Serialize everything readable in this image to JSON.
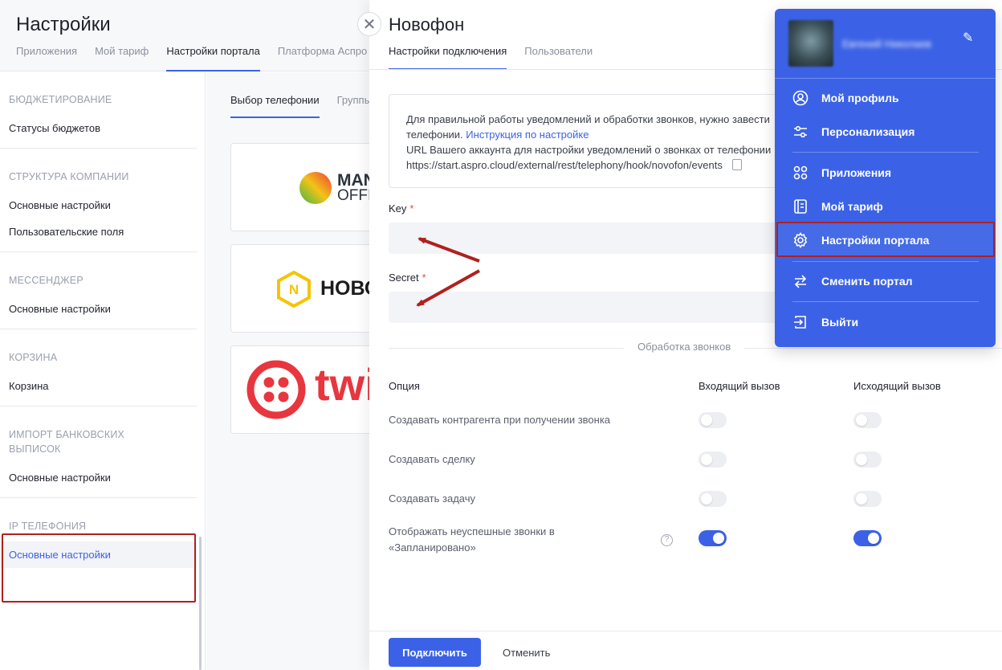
{
  "settings": {
    "title": "Настройки",
    "tabs": [
      "Приложения",
      "Мой тариф",
      "Настройки портала",
      "Платформа Аспро"
    ],
    "active_tab": "Настройки портала"
  },
  "sidebar": {
    "sections": [
      {
        "heading": "БЮДЖЕТИРОВАНИЕ",
        "items": [
          "Статусы бюджетов"
        ]
      },
      {
        "heading": "СТРУКТУРА КОМПАНИИ",
        "items": [
          "Основные настройки",
          "Пользовательские поля"
        ]
      },
      {
        "heading": "МЕССЕНДЖЕР",
        "items": [
          "Основные настройки"
        ]
      },
      {
        "heading": "КОРЗИНА",
        "items": [
          "Корзина"
        ]
      },
      {
        "heading": "ИМПОРТ БАНКОВСКИХ ВЫПИСОК",
        "items": [
          "Основные настройки"
        ]
      },
      {
        "heading": "IP ТЕЛЕФОНИЯ",
        "items": [
          "Основные настройки"
        ]
      }
    ],
    "active_item": "Основные настройки"
  },
  "telephony": {
    "tabs": [
      "Выбор телефонии",
      "Группы"
    ],
    "providers": [
      {
        "name": "MANGO OFFICE",
        "line1": "MANGO",
        "line2": "OFFICE"
      },
      {
        "name": "НОВОФОН",
        "line1": "НОВОФОН"
      },
      {
        "name": "twilio",
        "line1": "twilio"
      }
    ]
  },
  "panel": {
    "close_glyph": "✕",
    "title": "Новофон",
    "tabs": [
      "Настройки подключения",
      "Пользователи"
    ],
    "info": {
      "line1": "Для правильной работы уведомлений и обработки звонков, нужно завести",
      "line2_prefix": "телефонии.",
      "link": "Инструкция по настройке",
      "line3": "URL Вашего аккаунта для настройки уведомлений о звонках от телефонии",
      "url": "https://start.aspro.cloud/external/rest/telephony/hook/novofon/events"
    },
    "fields": {
      "key_label": "Key",
      "key_value": "",
      "secret_label": "Secret",
      "secret_value": "",
      "required_mark": "*"
    },
    "section_title": "Обработка звонков",
    "options": {
      "headers": {
        "option": "Опция",
        "incoming": "Входящий вызов",
        "outgoing": "Исходящий вызов"
      },
      "rows": [
        {
          "label": "Создавать контрагента при получении звонка",
          "incoming": false,
          "outgoing": false
        },
        {
          "label": "Создавать сделку",
          "incoming": false,
          "outgoing": false
        },
        {
          "label": "Создавать задачу",
          "incoming": false,
          "outgoing": false
        },
        {
          "label_line1": "Отображать неуспешные звонки в",
          "label_line2": "«Запланировано»",
          "incoming": true,
          "outgoing": true
        }
      ],
      "help_glyph": "?"
    },
    "footer": {
      "connect": "Подключить",
      "cancel": "Отменить"
    }
  },
  "profile_menu": {
    "user_name": "Евгений Николаев",
    "items": [
      {
        "label": "Мой профиль",
        "icon": "user-circle-icon"
      },
      {
        "label": "Персонализация",
        "icon": "sliders-icon"
      },
      {
        "label": "Приложения",
        "icon": "apps-grid-icon"
      },
      {
        "label": "Мой тариф",
        "icon": "tariff-icon"
      },
      {
        "label": "Настройки портала",
        "icon": "gear-icon"
      },
      {
        "label": "Сменить портал",
        "icon": "swap-arrows-icon"
      },
      {
        "label": "Выйти",
        "icon": "logout-icon"
      }
    ],
    "highlighted": "Настройки портала"
  },
  "colors": {
    "accent": "#3b62e6",
    "annotation_red": "#b0201e"
  }
}
